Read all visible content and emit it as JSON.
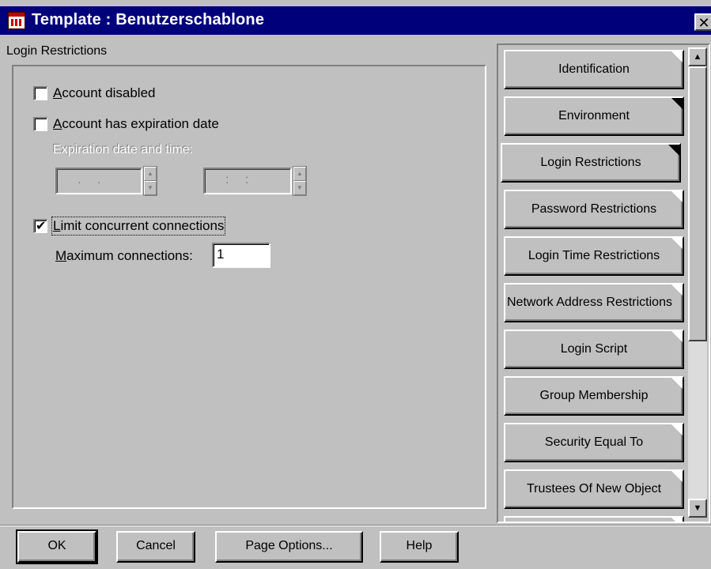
{
  "window": {
    "title": "Template : Benutzerschablone",
    "close_glyph": "✕"
  },
  "panel": {
    "title": "Login Restrictions",
    "account_disabled": {
      "prefix": "A",
      "rest": "ccount disabled",
      "checked": false
    },
    "account_expiration": {
      "prefix": "A",
      "rest": "ccount has expiration date",
      "checked": false
    },
    "expiration_label": "Expiration date and time:",
    "date_placeholder": ". .",
    "time_placeholder": ": :",
    "limit_connections": {
      "prefix": "L",
      "rest": "imit concurrent connections",
      "checked": true
    },
    "max_connections": {
      "prefix": "M",
      "rest": "aximum connections:",
      "value": "1"
    }
  },
  "tabs": [
    {
      "label": "Identification"
    },
    {
      "label": "Environment"
    },
    {
      "label": "Login Restrictions"
    },
    {
      "label": "Password Restrictions"
    },
    {
      "label": "Login Time Restrictions"
    },
    {
      "label": "Network Address Restrictions"
    },
    {
      "label": "Login Script"
    },
    {
      "label": "Group Membership"
    },
    {
      "label": "Security Equal To"
    },
    {
      "label": "Trustees Of New Object"
    }
  ],
  "active_tab": "Login Restrictions",
  "scrollbar": {
    "up_glyph": "▲",
    "down_glyph": "▼"
  },
  "buttons": {
    "ok": "OK",
    "cancel": "Cancel",
    "page_options": "Page Options...",
    "help": "Help"
  }
}
